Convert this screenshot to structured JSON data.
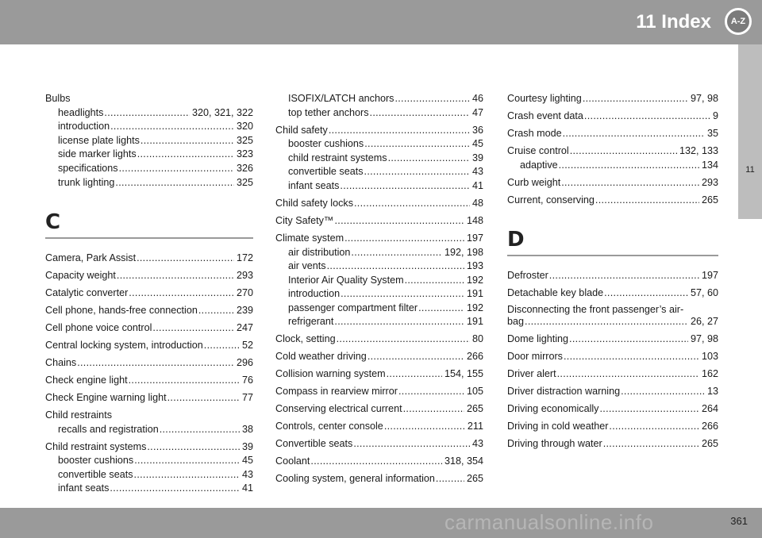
{
  "header": {
    "title": "11 Index",
    "badge": "A-Z"
  },
  "sidetab": {
    "label": "11"
  },
  "footer": {
    "page": "361"
  },
  "watermark": "carmanualsonline.info",
  "col1": {
    "bulbs": {
      "head": "Bulbs",
      "items": [
        {
          "t": "headlights",
          "p": "320, 321, 322"
        },
        {
          "t": "introduction",
          "p": "320"
        },
        {
          "t": "license plate lights",
          "p": "325"
        },
        {
          "t": "side marker lights",
          "p": "323"
        },
        {
          "t": "specifications",
          "p": "326"
        },
        {
          "t": "trunk lighting",
          "p": "325"
        }
      ]
    },
    "letter": "C",
    "entries": [
      {
        "t": "Camera, Park Assist",
        "p": "172"
      },
      {
        "t": "Capacity weight",
        "p": "293"
      },
      {
        "t": "Catalytic converter",
        "p": "270"
      },
      {
        "t": "Cell phone, hands-free connection",
        "p": "239"
      },
      {
        "t": "Cell phone voice control",
        "p": "247"
      },
      {
        "t": "Central locking system, introduction",
        "p": "52"
      },
      {
        "t": "Chains",
        "p": "296"
      },
      {
        "t": "Check engine light",
        "p": "76"
      },
      {
        "t": "Check Engine warning light",
        "p": "77"
      }
    ],
    "child_restraints": {
      "head": "Child restraints",
      "items": [
        {
          "t": "recalls and registration",
          "p": "38"
        }
      ]
    },
    "child_restraint_systems": {
      "t": "Child restraint systems",
      "p": "39",
      "items": [
        {
          "t": "booster cushions",
          "p": "45"
        },
        {
          "t": "convertible seats",
          "p": "43"
        },
        {
          "t": "infant seats",
          "p": "41"
        }
      ]
    }
  },
  "col2": {
    "top_items": [
      {
        "t": "ISOFIX/LATCH anchors",
        "p": "46"
      },
      {
        "t": "top tether anchors",
        "p": "47"
      }
    ],
    "child_safety": {
      "t": "Child safety",
      "p": "36",
      "items": [
        {
          "t": "booster cushions",
          "p": "45"
        },
        {
          "t": "child restraint systems",
          "p": "39"
        },
        {
          "t": "convertible seats",
          "p": "43"
        },
        {
          "t": "infant seats",
          "p": "41"
        }
      ]
    },
    "entries_a": [
      {
        "t": "Child safety locks",
        "p": "48"
      },
      {
        "t": "City Safety™",
        "p": "148"
      }
    ],
    "climate": {
      "t": "Climate system",
      "p": "197",
      "items": [
        {
          "t": "air distribution",
          "p": "192, 198"
        },
        {
          "t": "air vents",
          "p": "193"
        },
        {
          "t": "Interior Air Quality System",
          "p": "192"
        },
        {
          "t": "introduction",
          "p": "191"
        },
        {
          "t": "passenger compartment filter",
          "p": "192"
        },
        {
          "t": "refrigerant",
          "p": "191"
        }
      ]
    },
    "entries_b": [
      {
        "t": "Clock, setting",
        "p": "80"
      },
      {
        "t": "Cold weather driving",
        "p": "266"
      },
      {
        "t": "Collision warning system",
        "p": "154, 155"
      },
      {
        "t": "Compass in rearview mirror",
        "p": "105"
      },
      {
        "t": "Conserving electrical current",
        "p": "265"
      },
      {
        "t": "Controls, center console",
        "p": "211"
      },
      {
        "t": "Convertible seats",
        "p": "43"
      },
      {
        "t": "Coolant",
        "p": "318, 354"
      },
      {
        "t": "Cooling system, general information",
        "p": "265"
      }
    ]
  },
  "col3": {
    "entries_a": [
      {
        "t": "Courtesy lighting",
        "p": "97, 98"
      },
      {
        "t": "Crash event data",
        "p": "9"
      },
      {
        "t": "Crash mode",
        "p": "35"
      }
    ],
    "cruise": {
      "t": "Cruise control",
      "p": "132, 133",
      "items": [
        {
          "t": "adaptive",
          "p": "134"
        }
      ]
    },
    "entries_b": [
      {
        "t": "Curb weight",
        "p": "293"
      },
      {
        "t": "Current, conserving",
        "p": "265"
      }
    ],
    "letter": "D",
    "entries_c": [
      {
        "t": "Defroster",
        "p": "197"
      },
      {
        "t": "Detachable key blade",
        "p": "57, 60"
      }
    ],
    "disconnect": {
      "line1": "Disconnecting the front passenger’s air-",
      "t": "bag",
      "p": "26, 27"
    },
    "entries_d": [
      {
        "t": "Dome lighting",
        "p": "97, 98"
      },
      {
        "t": "Door mirrors",
        "p": "103"
      },
      {
        "t": "Driver alert",
        "p": "162"
      },
      {
        "t": "Driver distraction warning",
        "p": "13"
      },
      {
        "t": "Driving economically",
        "p": "264"
      },
      {
        "t": "Driving in cold weather",
        "p": "266"
      },
      {
        "t": "Driving through water",
        "p": "265"
      }
    ]
  }
}
